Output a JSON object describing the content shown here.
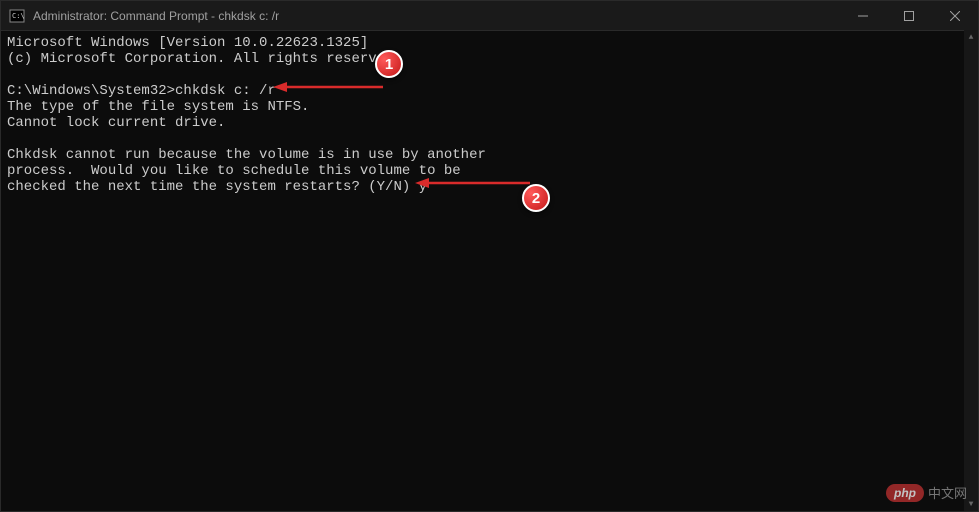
{
  "titlebar": {
    "title": "Administrator: Command Prompt - chkdsk  c: /r"
  },
  "terminal": {
    "line1": "Microsoft Windows [Version 10.0.22623.1325]",
    "line2": "(c) Microsoft Corporation. All rights reserved.",
    "line3": "",
    "prompt": "C:\\Windows\\System32>",
    "command": "chkdsk c: /r",
    "line5": "The type of the file system is NTFS.",
    "line6": "Cannot lock current drive.",
    "line7": "",
    "line8": "Chkdsk cannot run because the volume is in use by another",
    "line9": "process.  Would you like to schedule this volume to be",
    "line10": "checked the next time the system restarts? (Y/N) y"
  },
  "annotations": {
    "badge1": "1",
    "badge2": "2"
  },
  "watermark": {
    "logo": "php",
    "text": "中文网"
  }
}
